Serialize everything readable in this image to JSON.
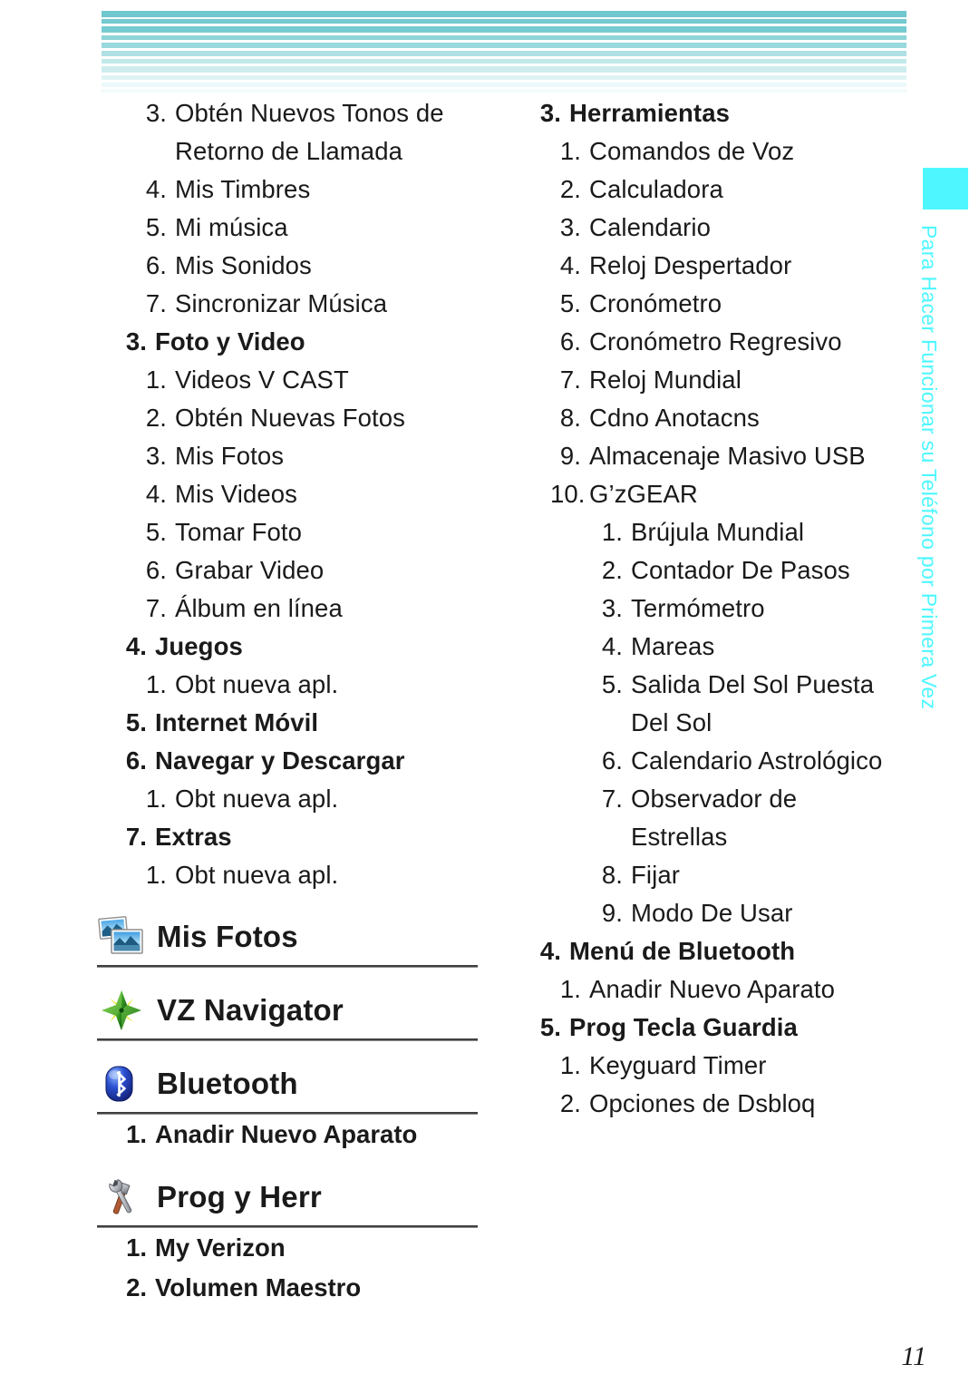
{
  "page": {
    "number": "11",
    "side_tab_text": "Para Hacer Funcionar su Teléfono por Primera Vez",
    "accent_cyan": "#4ef7ff",
    "header_stripe_color": "#6ec8cd"
  },
  "left_column": {
    "outline": [
      {
        "level": 1,
        "num": "3.",
        "text": "Obtén Nuevos Tonos de"
      },
      {
        "level": 1,
        "num": "",
        "text": "Retorno de Llamada",
        "continuation": true
      },
      {
        "level": 1,
        "num": "4.",
        "text": "Mis Timbres"
      },
      {
        "level": 1,
        "num": "5.",
        "text": "Mi música"
      },
      {
        "level": 1,
        "num": "6.",
        "text": "Mis Sonidos"
      },
      {
        "level": 1,
        "num": "7.",
        "text": "Sincronizar Música"
      },
      {
        "level": 0,
        "num": "3.",
        "text": "Foto y Video"
      },
      {
        "level": 1,
        "num": "1.",
        "text": "Videos V CAST"
      },
      {
        "level": 1,
        "num": "2.",
        "text": "Obtén Nuevas Fotos"
      },
      {
        "level": 1,
        "num": "3.",
        "text": "Mis Fotos"
      },
      {
        "level": 1,
        "num": "4.",
        "text": "Mis Videos"
      },
      {
        "level": 1,
        "num": "5.",
        "text": "Tomar Foto"
      },
      {
        "level": 1,
        "num": "6.",
        "text": "Grabar Video"
      },
      {
        "level": 1,
        "num": "7.",
        "text": "Álbum en línea"
      },
      {
        "level": 0,
        "num": "4.",
        "text": "Juegos"
      },
      {
        "level": 1,
        "num": "1.",
        "text": "Obt nueva apl."
      },
      {
        "level": 0,
        "num": "5.",
        "text": "Internet Móvil"
      },
      {
        "level": 0,
        "num": "6.",
        "text": "Navegar y Descargar"
      },
      {
        "level": 1,
        "num": "1.",
        "text": "Obt nueva apl."
      },
      {
        "level": 0,
        "num": "7.",
        "text": "Extras"
      },
      {
        "level": 1,
        "num": "1.",
        "text": "Obt nueva apl."
      }
    ],
    "icon_sections": [
      {
        "icon": "photos-icon",
        "title": "Mis Fotos",
        "items": []
      },
      {
        "icon": "compass-icon",
        "title": "VZ Navigator",
        "items": []
      },
      {
        "icon": "bluetooth-icon",
        "title": "Bluetooth",
        "items": [
          {
            "num": "1.",
            "text": "Anadir Nuevo Aparato"
          }
        ]
      },
      {
        "icon": "tools-icon",
        "title": "Prog y Herr",
        "items": [
          {
            "num": "1.",
            "text": "My Verizon"
          },
          {
            "num": "2.",
            "text": "Volumen Maestro"
          }
        ]
      }
    ]
  },
  "right_column": {
    "outline": [
      {
        "level": 0,
        "num": "3.",
        "text": "Herramientas"
      },
      {
        "level": 1,
        "num": "1.",
        "text": "Comandos de Voz"
      },
      {
        "level": 1,
        "num": "2.",
        "text": "Calculadora"
      },
      {
        "level": 1,
        "num": "3.",
        "text": "Calendario"
      },
      {
        "level": 1,
        "num": "4.",
        "text": "Reloj Despertador"
      },
      {
        "level": 1,
        "num": "5.",
        "text": "Cronómetro"
      },
      {
        "level": 1,
        "num": "6.",
        "text": "Cronómetro Regresivo"
      },
      {
        "level": 1,
        "num": "7.",
        "text": "Reloj Mundial"
      },
      {
        "level": 1,
        "num": "8.",
        "text": "Cdno Anotacns"
      },
      {
        "level": 1,
        "num": "9.",
        "text": "Almacenaje Masivo USB"
      },
      {
        "level": 1,
        "num": "10.",
        "text": "G’zGEAR"
      },
      {
        "level": 2,
        "num": "1.",
        "text": "Brújula Mundial"
      },
      {
        "level": 2,
        "num": "2.",
        "text": "Contador De Pasos"
      },
      {
        "level": 2,
        "num": "3.",
        "text": "Termómetro"
      },
      {
        "level": 2,
        "num": "4.",
        "text": "Mareas"
      },
      {
        "level": 2,
        "num": "5.",
        "text": "Salida Del Sol Puesta"
      },
      {
        "level": 2,
        "num": "",
        "text": "Del Sol",
        "continuation": true
      },
      {
        "level": 2,
        "num": "6.",
        "text": "Calendario Astrológico"
      },
      {
        "level": 2,
        "num": "7.",
        "text": "Observador de"
      },
      {
        "level": 2,
        "num": "",
        "text": "Estrellas",
        "continuation": true
      },
      {
        "level": 2,
        "num": "8.",
        "text": "Fijar"
      },
      {
        "level": 2,
        "num": "9.",
        "text": "Modo De Usar"
      },
      {
        "level": 0,
        "num": "4.",
        "text": "Menú de Bluetooth"
      },
      {
        "level": 1,
        "num": "1.",
        "text": "Anadir Nuevo Aparato"
      },
      {
        "level": 0,
        "num": "5.",
        "text": "Prog Tecla Guardia"
      },
      {
        "level": 1,
        "num": "1.",
        "text": "Keyguard Timer"
      },
      {
        "level": 1,
        "num": "2.",
        "text": "Opciones de Dsbloq"
      }
    ]
  }
}
